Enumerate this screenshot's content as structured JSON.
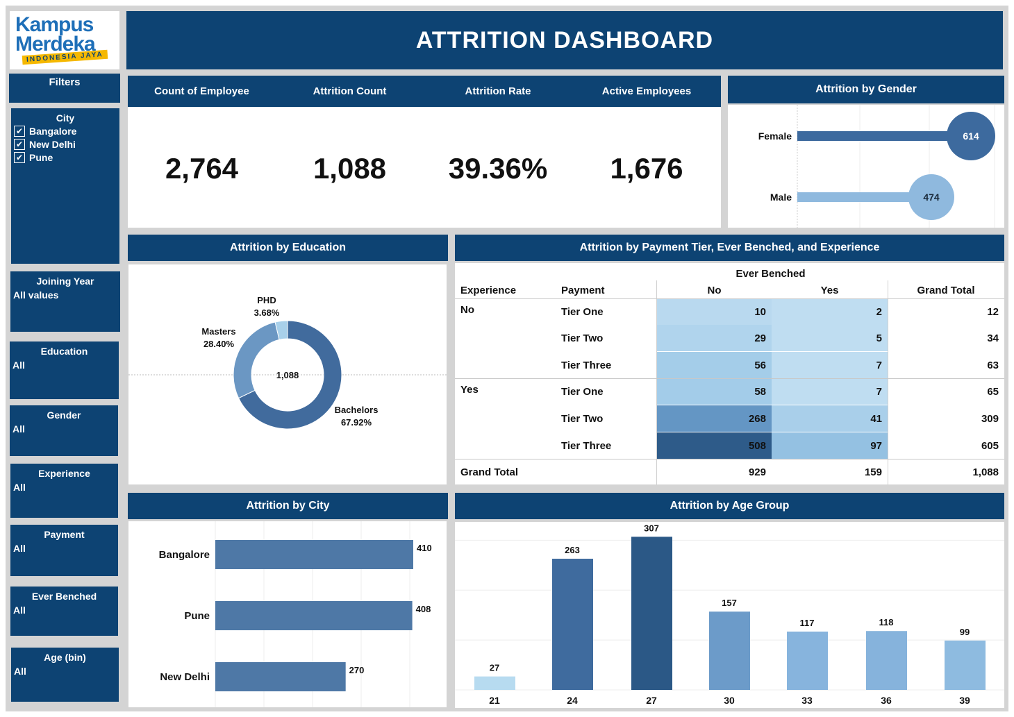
{
  "logo": {
    "line1": "Kampus",
    "line2": "Merdeka",
    "tagline": "INDONESIA JAYA"
  },
  "title": "ATTRITION DASHBOARD",
  "filters": {
    "heading": "Filters",
    "city": {
      "label": "City",
      "options": [
        "Bangalore",
        "New Delhi",
        "Pune"
      ]
    },
    "joining_year": {
      "label": "Joining Year",
      "value": "All values"
    },
    "education": {
      "label": "Education",
      "value": "All"
    },
    "gender": {
      "label": "Gender",
      "value": "All"
    },
    "experience": {
      "label": "Experience",
      "value": "All"
    },
    "payment": {
      "label": "Payment",
      "value": "All"
    },
    "ever_benched": {
      "label": "Ever Benched",
      "value": "All"
    },
    "age_bin": {
      "label": "Age (bin)",
      "value": "All"
    }
  },
  "kpis": [
    {
      "label": "Count of Employee",
      "value": "2,764"
    },
    {
      "label": "Attrition Count",
      "value": "1,088"
    },
    {
      "label": "Attrition Rate",
      "value": "39.36%"
    },
    {
      "label": "Active Employees",
      "value": "1,676"
    }
  ],
  "gender_panel": {
    "title": "Attrition by Gender"
  },
  "education_panel": {
    "title": "Attrition by Education",
    "center_label": "1,088"
  },
  "tier_panel": {
    "title": "Attrition by Payment Tier, Ever Benched, and Experience",
    "col_group": "Ever Benched",
    "headers": [
      "Experience",
      "Payment",
      "No",
      "Yes",
      "Grand Total"
    ],
    "groups": [
      {
        "experience": "No",
        "rows": [
          {
            "payment": "Tier One",
            "no": "10",
            "yes": "2",
            "total": "12"
          },
          {
            "payment": "Tier Two",
            "no": "29",
            "yes": "5",
            "total": "34"
          },
          {
            "payment": "Tier Three",
            "no": "56",
            "yes": "7",
            "total": "63"
          }
        ]
      },
      {
        "experience": "Yes",
        "rows": [
          {
            "payment": "Tier One",
            "no": "58",
            "yes": "7",
            "total": "65"
          },
          {
            "payment": "Tier Two",
            "no": "268",
            "yes": "41",
            "total": "309"
          },
          {
            "payment": "Tier Three",
            "no": "508",
            "yes": "97",
            "total": "605"
          }
        ]
      }
    ],
    "grand_total": {
      "label": "Grand Total",
      "no": "929",
      "yes": "159",
      "total": "1,088"
    },
    "colors": {
      "c10": "#b9d9ef",
      "c29": "#b0d4ed",
      "c56": "#a4cde9",
      "c58": "#a3cce9",
      "c268": "#6496c4",
      "c508": "#2e5b89",
      "cyes_low": "#bfddf1",
      "c41": "#a9cfea",
      "c97": "#94c1e2"
    }
  },
  "city_panel": {
    "title": "Attrition by City"
  },
  "age_panel": {
    "title": "Attrition by Age Group"
  },
  "chart_data": [
    {
      "type": "bar",
      "title": "Attrition by Gender",
      "categories": [
        "Female",
        "Male"
      ],
      "values": [
        614,
        474
      ],
      "colors": [
        "#3d6a9e",
        "#8fb9de"
      ]
    },
    {
      "type": "pie",
      "title": "Attrition by Education",
      "categories": [
        "Bachelors",
        "Masters",
        "PHD"
      ],
      "values": [
        67.92,
        28.4,
        3.68
      ],
      "labels": [
        "67.92%",
        "28.40%",
        "3.68%"
      ],
      "colors": [
        "#416b9d",
        "#6b97c3",
        "#a8d0ea"
      ]
    },
    {
      "type": "bar",
      "title": "Attrition by City",
      "categories": [
        "Bangalore",
        "Pune",
        "New Delhi"
      ],
      "values": [
        410,
        408,
        270
      ],
      "color": "#4e78a6",
      "xlim": [
        0,
        430
      ]
    },
    {
      "type": "bar",
      "title": "Attrition by Age Group",
      "categories": [
        "21",
        "24",
        "27",
        "30",
        "33",
        "36",
        "39"
      ],
      "values": [
        27,
        263,
        307,
        157,
        117,
        118,
        99
      ],
      "colors": [
        "#b7dbf0",
        "#3f6b9e",
        "#2b5886",
        "#6c9bc9",
        "#87b4dd",
        "#86b3dc",
        "#8ebbe0"
      ],
      "ylim": [
        0,
        320
      ]
    }
  ]
}
